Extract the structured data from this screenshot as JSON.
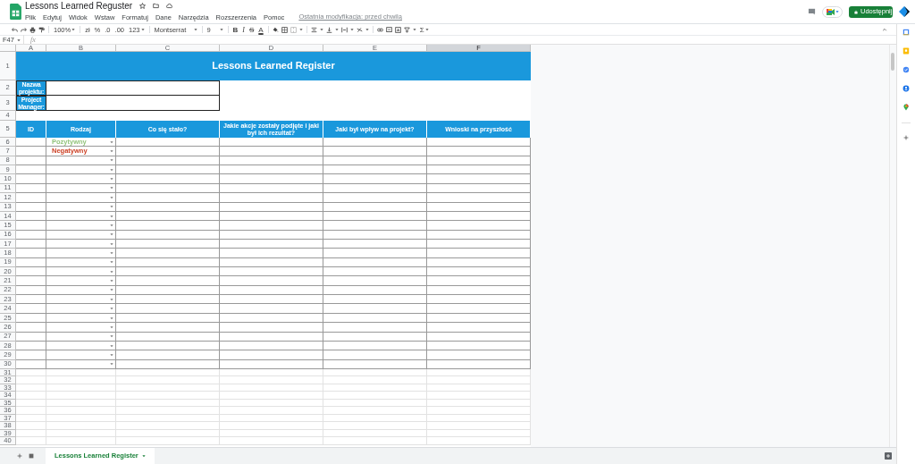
{
  "app": {
    "title": "Lessons Learned Reguster",
    "menu": [
      "Plik",
      "Edytuj",
      "Widok",
      "Wstaw",
      "Formatuj",
      "Dane",
      "Narzędzia",
      "Rozszerzenia",
      "Pomoc"
    ],
    "last_edit": "Ostatnia modyfikacja: przed chwilą",
    "share_button": "Udostępnij"
  },
  "toolbar": {
    "zoom": "100%",
    "currency": "zł",
    "percent": "%",
    "decimal_decrease": ".0",
    "decimal_increase": ".00",
    "number_format": "123",
    "font": "Montserrat",
    "font_size": "9",
    "bold": "B",
    "italic": "I",
    "strikethrough": "S",
    "text_color": "A",
    "functions": "Σ"
  },
  "formula_bar": {
    "cell_ref": "F47",
    "fx": "fx"
  },
  "columns": [
    {
      "label": "A",
      "selected": false
    },
    {
      "label": "B",
      "selected": false
    },
    {
      "label": "C",
      "selected": false
    },
    {
      "label": "D",
      "selected": false
    },
    {
      "label": "E",
      "selected": false
    },
    {
      "label": "F",
      "selected": true
    }
  ],
  "row_numbers": [
    "1",
    "2",
    "3",
    "4",
    "5",
    "6",
    "7",
    "8",
    "9",
    "10",
    "11",
    "12",
    "13",
    "14",
    "15",
    "16",
    "17",
    "18",
    "19",
    "20",
    "21",
    "22",
    "23",
    "24",
    "25",
    "26",
    "27",
    "28",
    "29",
    "30",
    "31",
    "32",
    "33",
    "34",
    "35",
    "36",
    "37",
    "38",
    "39",
    "40"
  ],
  "sheet": {
    "title": "Lessons Learned Register",
    "info_fields": [
      {
        "label": "Nazwa projektu:"
      },
      {
        "label": "Project Manager:"
      }
    ],
    "headers": [
      "ID",
      "Rodzaj",
      "Co się stało?",
      "Jakie akcje zostały podjęte i jaki był ich rezultat?",
      "Jaki był wpływ na projekt?",
      "Wnioski na przyszłość"
    ],
    "rows": [
      {
        "value": "Pozytywny",
        "color": "#93c47d"
      },
      {
        "value": "Negatywny",
        "color": "#cc4125"
      },
      {},
      {},
      {},
      {},
      {},
      {},
      {},
      {},
      {},
      {},
      {},
      {},
      {},
      {},
      {},
      {},
      {},
      {},
      {},
      {},
      {},
      {},
      {}
    ]
  },
  "sheet_tabs": [
    {
      "label": "Lessons Learned Register",
      "selected": true
    }
  ]
}
